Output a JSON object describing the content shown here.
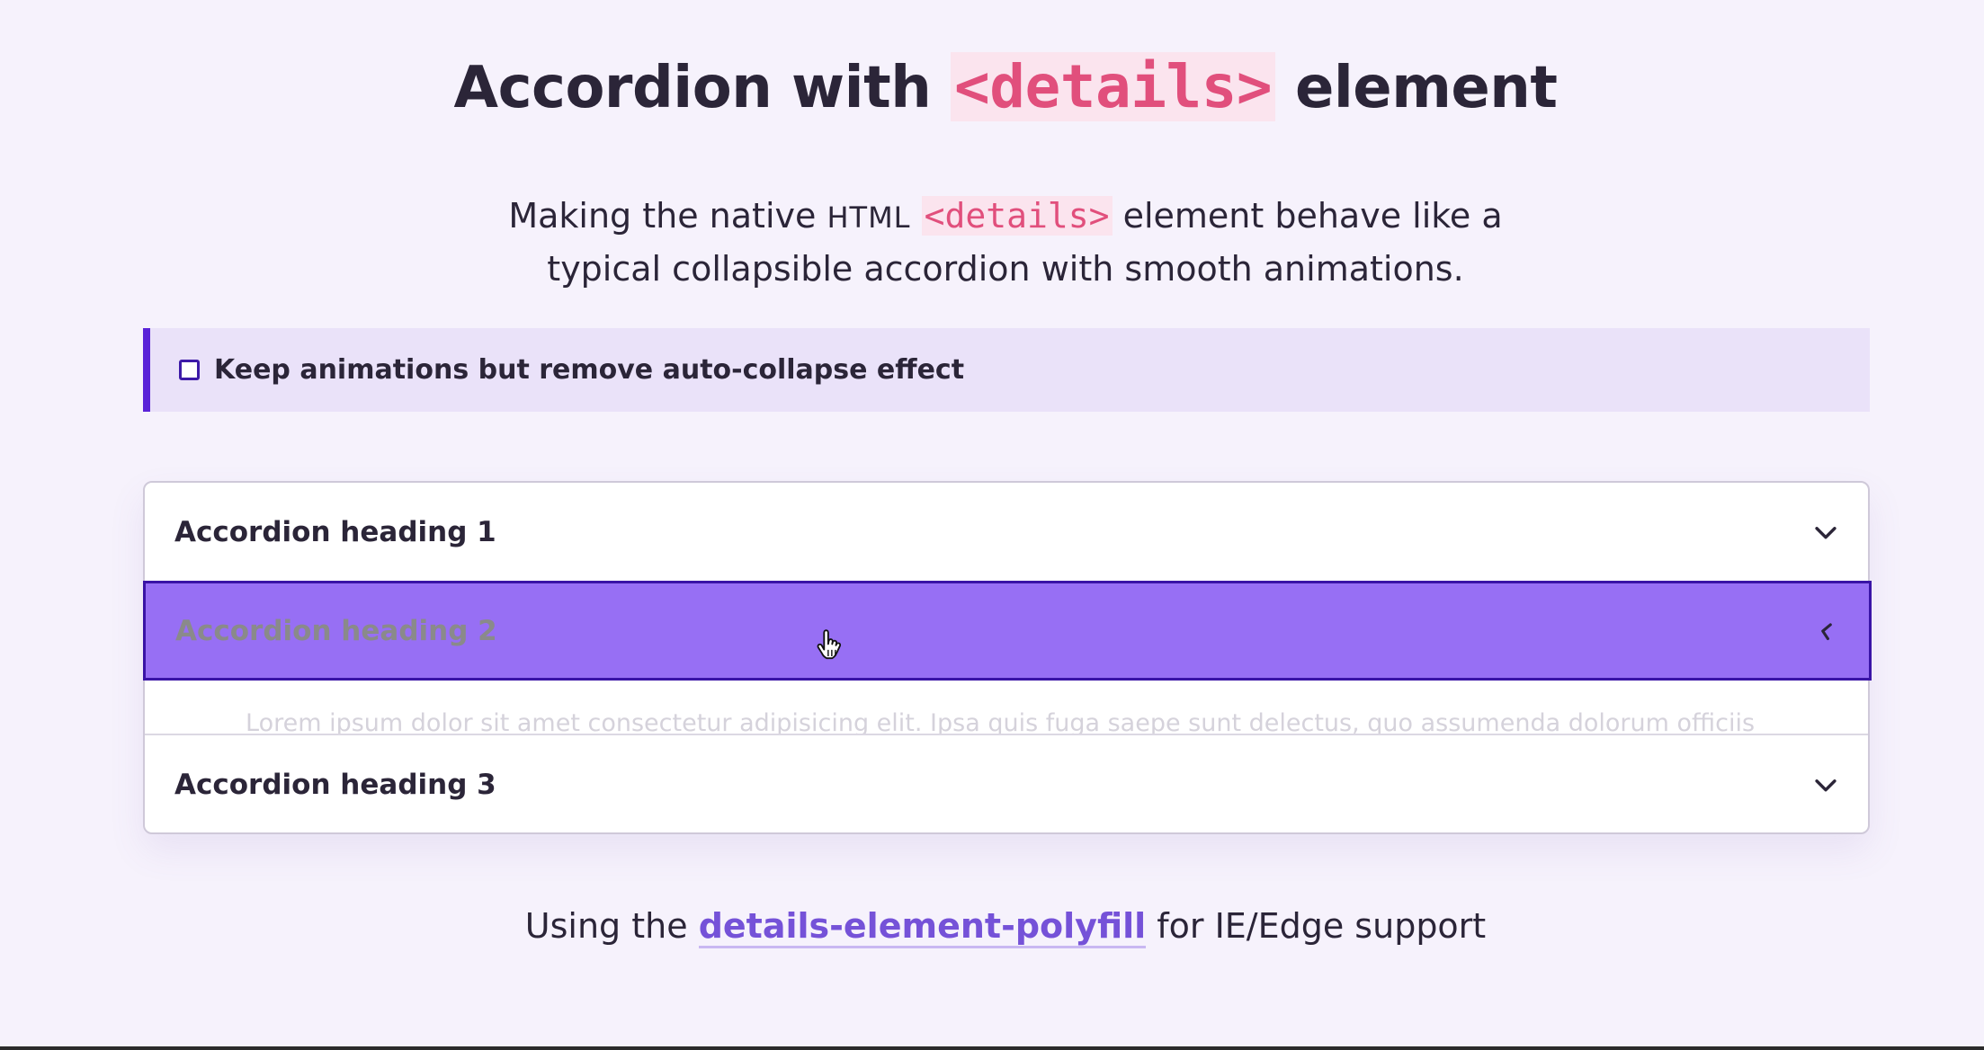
{
  "page": {
    "title_before": "Accordion with ",
    "title_code": "<details>",
    "title_after": " element",
    "subtitle_part1": "Making the native ",
    "subtitle_abbr": "HTML",
    "subtitle_code": "<details>",
    "subtitle_part2": " element behave like a",
    "subtitle_line2": "typical collapsible accordion with smooth animations."
  },
  "notice": {
    "checkbox_checked": false,
    "label": "Keep animations but remove auto-collapse effect",
    "accent_color": "#5a23d8"
  },
  "accordion": {
    "items": [
      {
        "heading": "Accordion heading 1",
        "state": "collapsed",
        "icon": "chevron-down-icon"
      },
      {
        "heading": "Accordion heading 2",
        "state": "hover-animating",
        "icon": "chevron-left-icon",
        "highlight_color": "#976ff4"
      },
      {
        "heading": "Accordion heading 3",
        "state": "collapsed",
        "icon": "chevron-down-icon"
      }
    ],
    "panel_text": "Lorem ipsum dolor sit amet consectetur adipisicing elit. Ipsa quis fuga saepe sunt delectus, quo assumenda dolorum officiis"
  },
  "footer": {
    "text_before": "Using the ",
    "link_text": "details-element-polyfill",
    "text_after": " for IE/Edge support",
    "link_color": "#7552d8"
  },
  "cursor": {
    "icon": "hand-pointer-icon"
  }
}
